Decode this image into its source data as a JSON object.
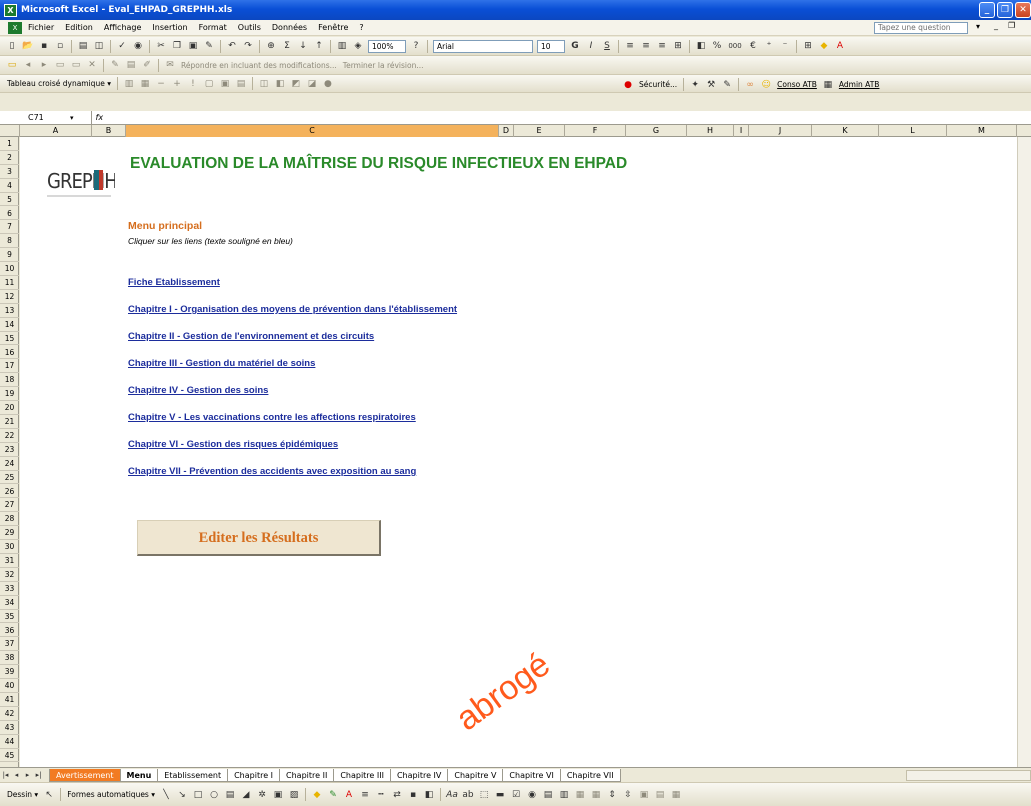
{
  "window": {
    "title": "Microsoft Excel - Eval_EHPAD_GREPHH.xls",
    "app_icon": "excel-icon",
    "controls": [
      "_",
      "❐",
      "✕"
    ]
  },
  "menubar": {
    "items": [
      "Fichier",
      "Edition",
      "Affichage",
      "Insertion",
      "Format",
      "Outils",
      "Données",
      "Fenêtre",
      "?"
    ],
    "ask_placeholder": "Tapez une question"
  },
  "toolbar_standard": {
    "zoom": "100%",
    "font": "Arial",
    "font_size": "10",
    "bold": "G",
    "italic": "I",
    "underline": "S",
    "percent": "%",
    "thousands": "000",
    "currency": "€"
  },
  "toolbar_review": {
    "reply_label": "Répondre en incluant des modifications...",
    "end_review_label": "Terminer la révision..."
  },
  "toolbar_pivot": {
    "pivot_label": "Tableau croisé dynamique ▾",
    "security_label": "Sécurité...",
    "conso_label": "Conso ATB",
    "admin_label": "Admin ATB"
  },
  "formula_bar": {
    "name_box": "C71",
    "fx": "fx",
    "content": ""
  },
  "columns": [
    "A",
    "B",
    "C",
    "D",
    "E",
    "F",
    "G",
    "H",
    "I",
    "J",
    "K",
    "L",
    "M"
  ],
  "rows": [
    "1",
    "2",
    "3",
    "4",
    "5",
    "6",
    "7",
    "8",
    "9",
    "10",
    "11",
    "12",
    "13",
    "14",
    "15",
    "16",
    "17",
    "18",
    "19",
    "20",
    "21",
    "22",
    "23",
    "24",
    "25",
    "26",
    "27",
    "28",
    "29",
    "30",
    "31",
    "32",
    "33",
    "34",
    "35",
    "36",
    "37",
    "38",
    "39",
    "40",
    "41",
    "42",
    "43",
    "44",
    "45"
  ],
  "sheet": {
    "logo_text": "GREPHH",
    "title": "EVALUATION DE LA MAÎTRISE DU RISQUE INFECTIEUX EN EHPAD",
    "menu_title": "Menu principal",
    "menu_subtitle": "Cliquer sur les liens (texte souligné en bleu)",
    "links": [
      "Fiche Etablissement",
      "Chapitre I - Organisation des moyens de prévention dans l'établissement",
      "Chapitre II - Gestion de l'environnement et des circuits",
      "Chapitre III - Gestion du matériel de soins",
      "Chapitre IV - Gestion des soins",
      "Chapitre V - Les vaccinations contre les affections respiratoires",
      "Chapitre VI - Gestion des risques épidémiques",
      "Chapitre VII - Prévention des accidents avec exposition au sang"
    ],
    "edit_button": "Editer les Résultats",
    "watermark": "abrogé",
    "title_color": "#2a8a2a",
    "accent_color": "#d56e1e",
    "link_color": "#1c2d9c"
  },
  "sheet_tabs": [
    "Avertissement",
    "Menu",
    "Etablissement",
    "Chapitre I",
    "Chapitre II",
    "Chapitre III",
    "Chapitre IV",
    "Chapitre V",
    "Chapitre VI",
    "Chapitre VII"
  ],
  "active_tab": "Menu",
  "drawbar": {
    "draw_label": "Dessin ▾",
    "autoshapes_label": "Formes automatiques ▾"
  }
}
